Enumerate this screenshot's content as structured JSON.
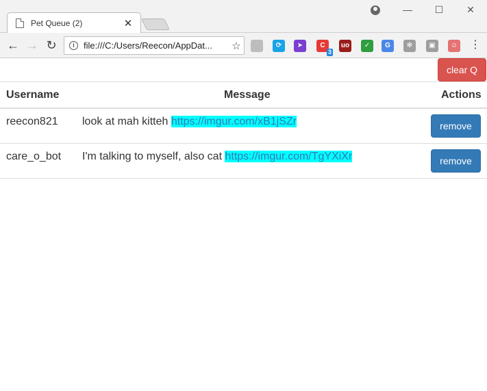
{
  "browser": {
    "tab_title": "Pet Queue (2)",
    "tab_close": "✕",
    "url": "file:///C:/Users/Reecon/AppDat...",
    "window_controls": {
      "minimize": "—",
      "maximize": "☐",
      "close": "✕"
    },
    "extensions": [
      {
        "name": "extension-gray-icon",
        "color": "#bdbdbd",
        "glyph": ""
      },
      {
        "name": "extension-share-icon",
        "color": "#1aa3e8",
        "glyph": "⟳"
      },
      {
        "name": "extension-cursor-icon",
        "color": "#7a3fd1",
        "glyph": "➤"
      },
      {
        "name": "extension-c-icon",
        "color": "#e53935",
        "glyph": "C",
        "badge": "3"
      },
      {
        "name": "ublock-icon",
        "color": "#9b1c1c",
        "glyph": "uo"
      },
      {
        "name": "extension-check-icon",
        "color": "#2e9e3e",
        "glyph": "✓"
      },
      {
        "name": "translate-icon",
        "color": "#4a86e8",
        "glyph": "G"
      },
      {
        "name": "extension-gear-icon",
        "color": "#9e9e9e",
        "glyph": "✻"
      },
      {
        "name": "extension-box-icon",
        "color": "#9e9e9e",
        "glyph": "▣"
      },
      {
        "name": "extension-face-icon",
        "color": "#e57373",
        "glyph": "☺"
      }
    ]
  },
  "page": {
    "clear_button": "clear Q",
    "columns": {
      "username": "Username",
      "message": "Message",
      "actions": "Actions"
    },
    "rows": [
      {
        "username": "reecon821",
        "message_text": "look at mah kitteh ",
        "link": "https://imgur.com/xB1jSZr",
        "action": "remove"
      },
      {
        "username": "care_o_bot",
        "message_text": "I'm talking to myself, also cat ",
        "link": "https://imgur.com/TgYXiXr",
        "action": "remove"
      }
    ]
  }
}
